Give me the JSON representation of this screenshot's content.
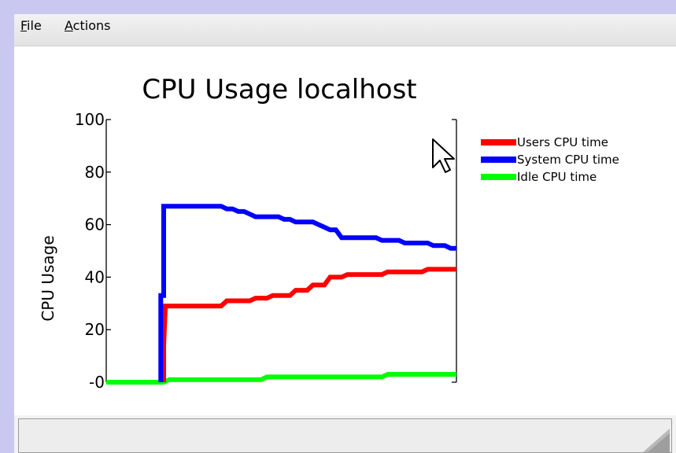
{
  "menubar": {
    "items": [
      {
        "mnemonic": "F",
        "rest": "ile"
      },
      {
        "mnemonic": "A",
        "rest": "ctions"
      }
    ]
  },
  "icons": {
    "cursor": "arrow-pointer-icon",
    "resize": "resize-grip-icon"
  },
  "colors": {
    "users": "#ff0000",
    "system": "#0000ff",
    "idle": "#00ff00",
    "desktop": "#c8c8f0"
  },
  "chart_data": {
    "type": "line",
    "title": "CPU Usage localhost",
    "xlabel": "",
    "ylabel": "CPU Usage",
    "ylim": [
      0,
      100
    ],
    "yticks": [
      "-0",
      "20",
      "40",
      "60",
      "80",
      "100"
    ],
    "xlim": [
      0,
      61
    ],
    "grid": false,
    "legend_position": "right",
    "series": [
      {
        "name": "Users CPU time",
        "color": "#ff0000",
        "points": [
          [
            10,
            0
          ],
          [
            10,
            14
          ],
          [
            10.3,
            29
          ],
          [
            20,
            29
          ],
          [
            21,
            31
          ],
          [
            25,
            31
          ],
          [
            26,
            32
          ],
          [
            28,
            32
          ],
          [
            29,
            33
          ],
          [
            32,
            33
          ],
          [
            33,
            35
          ],
          [
            35,
            35
          ],
          [
            36,
            37
          ],
          [
            38,
            37
          ],
          [
            39,
            40
          ],
          [
            41,
            40
          ],
          [
            42,
            41
          ],
          [
            48,
            41
          ],
          [
            49,
            42
          ],
          [
            55,
            42
          ],
          [
            56,
            43
          ],
          [
            61,
            43
          ]
        ]
      },
      {
        "name": "System CPU time",
        "color": "#0000ff",
        "points": [
          [
            9.5,
            0
          ],
          [
            9.5,
            33
          ],
          [
            10,
            33
          ],
          [
            10,
            67
          ],
          [
            20,
            67
          ],
          [
            21,
            66
          ],
          [
            22,
            66
          ],
          [
            23,
            65
          ],
          [
            24,
            65
          ],
          [
            25,
            64
          ],
          [
            26,
            63
          ],
          [
            30,
            63
          ],
          [
            31,
            62
          ],
          [
            32,
            62
          ],
          [
            33,
            61
          ],
          [
            36,
            61
          ],
          [
            37,
            60
          ],
          [
            38,
            59
          ],
          [
            39,
            58
          ],
          [
            40,
            58
          ],
          [
            41,
            55
          ],
          [
            47,
            55
          ],
          [
            48,
            54
          ],
          [
            51,
            54
          ],
          [
            52,
            53
          ],
          [
            56,
            53
          ],
          [
            57,
            52
          ],
          [
            59,
            52
          ],
          [
            60,
            51
          ],
          [
            61,
            51
          ]
        ]
      },
      {
        "name": "Idle CPU time",
        "color": "#00ff00",
        "points": [
          [
            0,
            0
          ],
          [
            10,
            0
          ],
          [
            11,
            1
          ],
          [
            27,
            1
          ],
          [
            28,
            2
          ],
          [
            48,
            2
          ],
          [
            49,
            3
          ],
          [
            61,
            3
          ]
        ]
      }
    ]
  }
}
